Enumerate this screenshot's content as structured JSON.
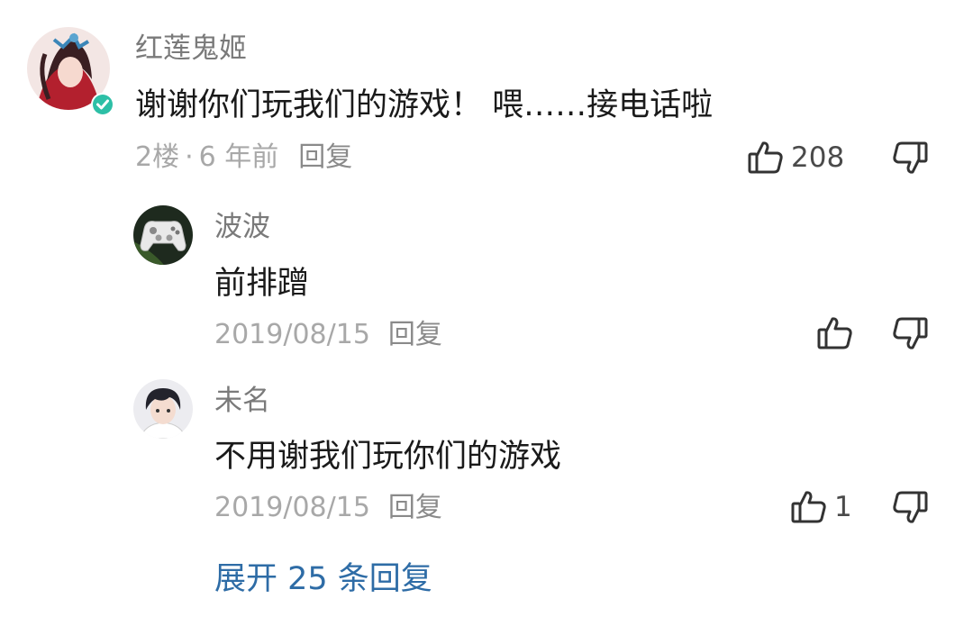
{
  "comment": {
    "author": "红莲鬼姬",
    "text": "谢谢你们玩我们的游戏！  喂……接电话啦",
    "floor": "2楼",
    "separator": "·",
    "time": "6 年前",
    "reply_label": "回复",
    "likes": "208",
    "verified_badge_color": "#2dbfa6",
    "icons": {
      "like": "thumbs-up-icon",
      "dislike": "thumbs-down-icon",
      "verified": "verified-check-icon"
    }
  },
  "replies": [
    {
      "author": "波波",
      "text": "前排蹭",
      "date": "2019/08/15",
      "reply_label": "回复",
      "likes": ""
    },
    {
      "author": "未名",
      "text": "不用谢我们玩你们的游戏",
      "date": "2019/08/15",
      "reply_label": "回复",
      "likes": "1"
    }
  ],
  "expand_label": "展开 25 条回复",
  "colors": {
    "link": "#2e6ca6",
    "meta": "#a8a8a8",
    "name": "#7a7a7a"
  }
}
